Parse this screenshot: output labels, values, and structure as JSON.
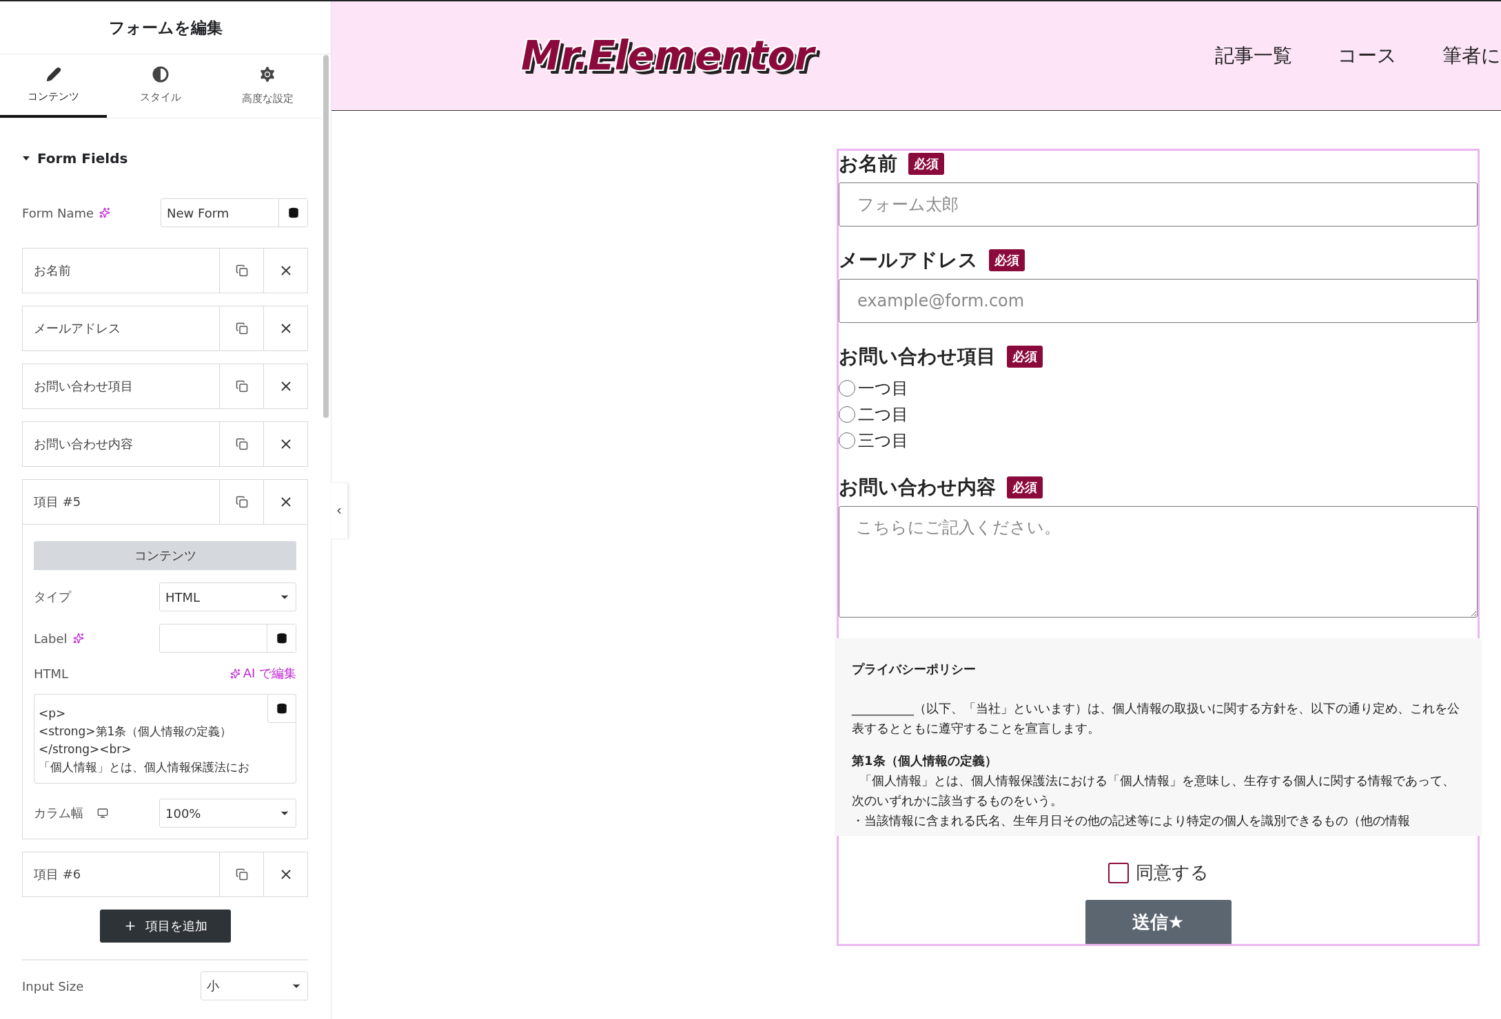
{
  "editor": {
    "title": "フォームを編集",
    "tabs": [
      {
        "label": "コンテンツ",
        "kind": "pencil",
        "selected": true
      },
      {
        "label": "スタイル",
        "kind": "contrast",
        "selected": false
      },
      {
        "label": "高度な設定",
        "kind": "gear",
        "selected": false
      }
    ],
    "section": {
      "title": "Form Fields",
      "expanded": true
    },
    "form_name": {
      "label": "Form Name",
      "value": "New Form"
    },
    "fields": [
      {
        "label": "お名前",
        "expanded": false
      },
      {
        "label": "メールアドレス",
        "expanded": false
      },
      {
        "label": "お問い合わせ項目",
        "expanded": false
      },
      {
        "label": "お問い合わせ内容",
        "expanded": false
      },
      {
        "label": "項目 #5",
        "expanded": true
      },
      {
        "label": "項目 #6",
        "expanded": false
      }
    ],
    "item_editor": {
      "tab": "コンテンツ",
      "type": {
        "label": "タイプ",
        "value": "HTML"
      },
      "label_field": {
        "label": "Label"
      },
      "html": {
        "label": "HTML",
        "ai_link": "AI で編集",
        "lines": [
          "<p>",
          "<strong>第1条（個人情報の定義）",
          "</strong><br>",
          "「個人情報」とは、個人情報保護法にお"
        ]
      },
      "column_width": {
        "label": "カラム幅",
        "value": "100%"
      }
    },
    "add_button": "項目を追加",
    "input_size": {
      "label": "Input Size",
      "value": "小"
    }
  },
  "site": {
    "logo": "Mr.Elementor",
    "nav": [
      "記事一覧",
      "コース",
      "筆者に"
    ]
  },
  "form": {
    "fields": [
      {
        "kind": "text",
        "label": "お名前",
        "badge": "必須",
        "placeholder": "フォーム太郎"
      },
      {
        "kind": "text",
        "label": "メールアドレス",
        "badge": "必須",
        "placeholder": "example@form.com"
      },
      {
        "kind": "radio",
        "label": "お問い合わせ項目",
        "badge": "必須",
        "options": [
          {
            "label": "一つ目",
            "selected": false
          },
          {
            "label": "二つ目",
            "selected": false
          },
          {
            "label": "三つ目",
            "selected": false
          }
        ]
      },
      {
        "kind": "textarea",
        "label": "お問い合わせ内容",
        "badge": "必須",
        "placeholder": "こちらにご記入ください。"
      }
    ],
    "privacy": {
      "title": "プライバシーポリシー",
      "intro": "__________（以下、「当社」といいます）は、個人情報の取扱いに関する方針を、以下の通り定め、これを公表するとともに遵守することを宣言します。",
      "heading": "第1条（個人情報の定義）",
      "body": "「個人情報」とは、個人情報保護法における「個人情報」を意味し、生存する個人に関する情報であって、次のいずれかに該当するものをいう。",
      "bullet": "・当該情報に含まれる氏名、生年月日その他の記述等により特定の個人を識別できるもの（他の情報"
    },
    "consent": {
      "label": "同意する",
      "checked": false
    },
    "submit": "送信★"
  }
}
